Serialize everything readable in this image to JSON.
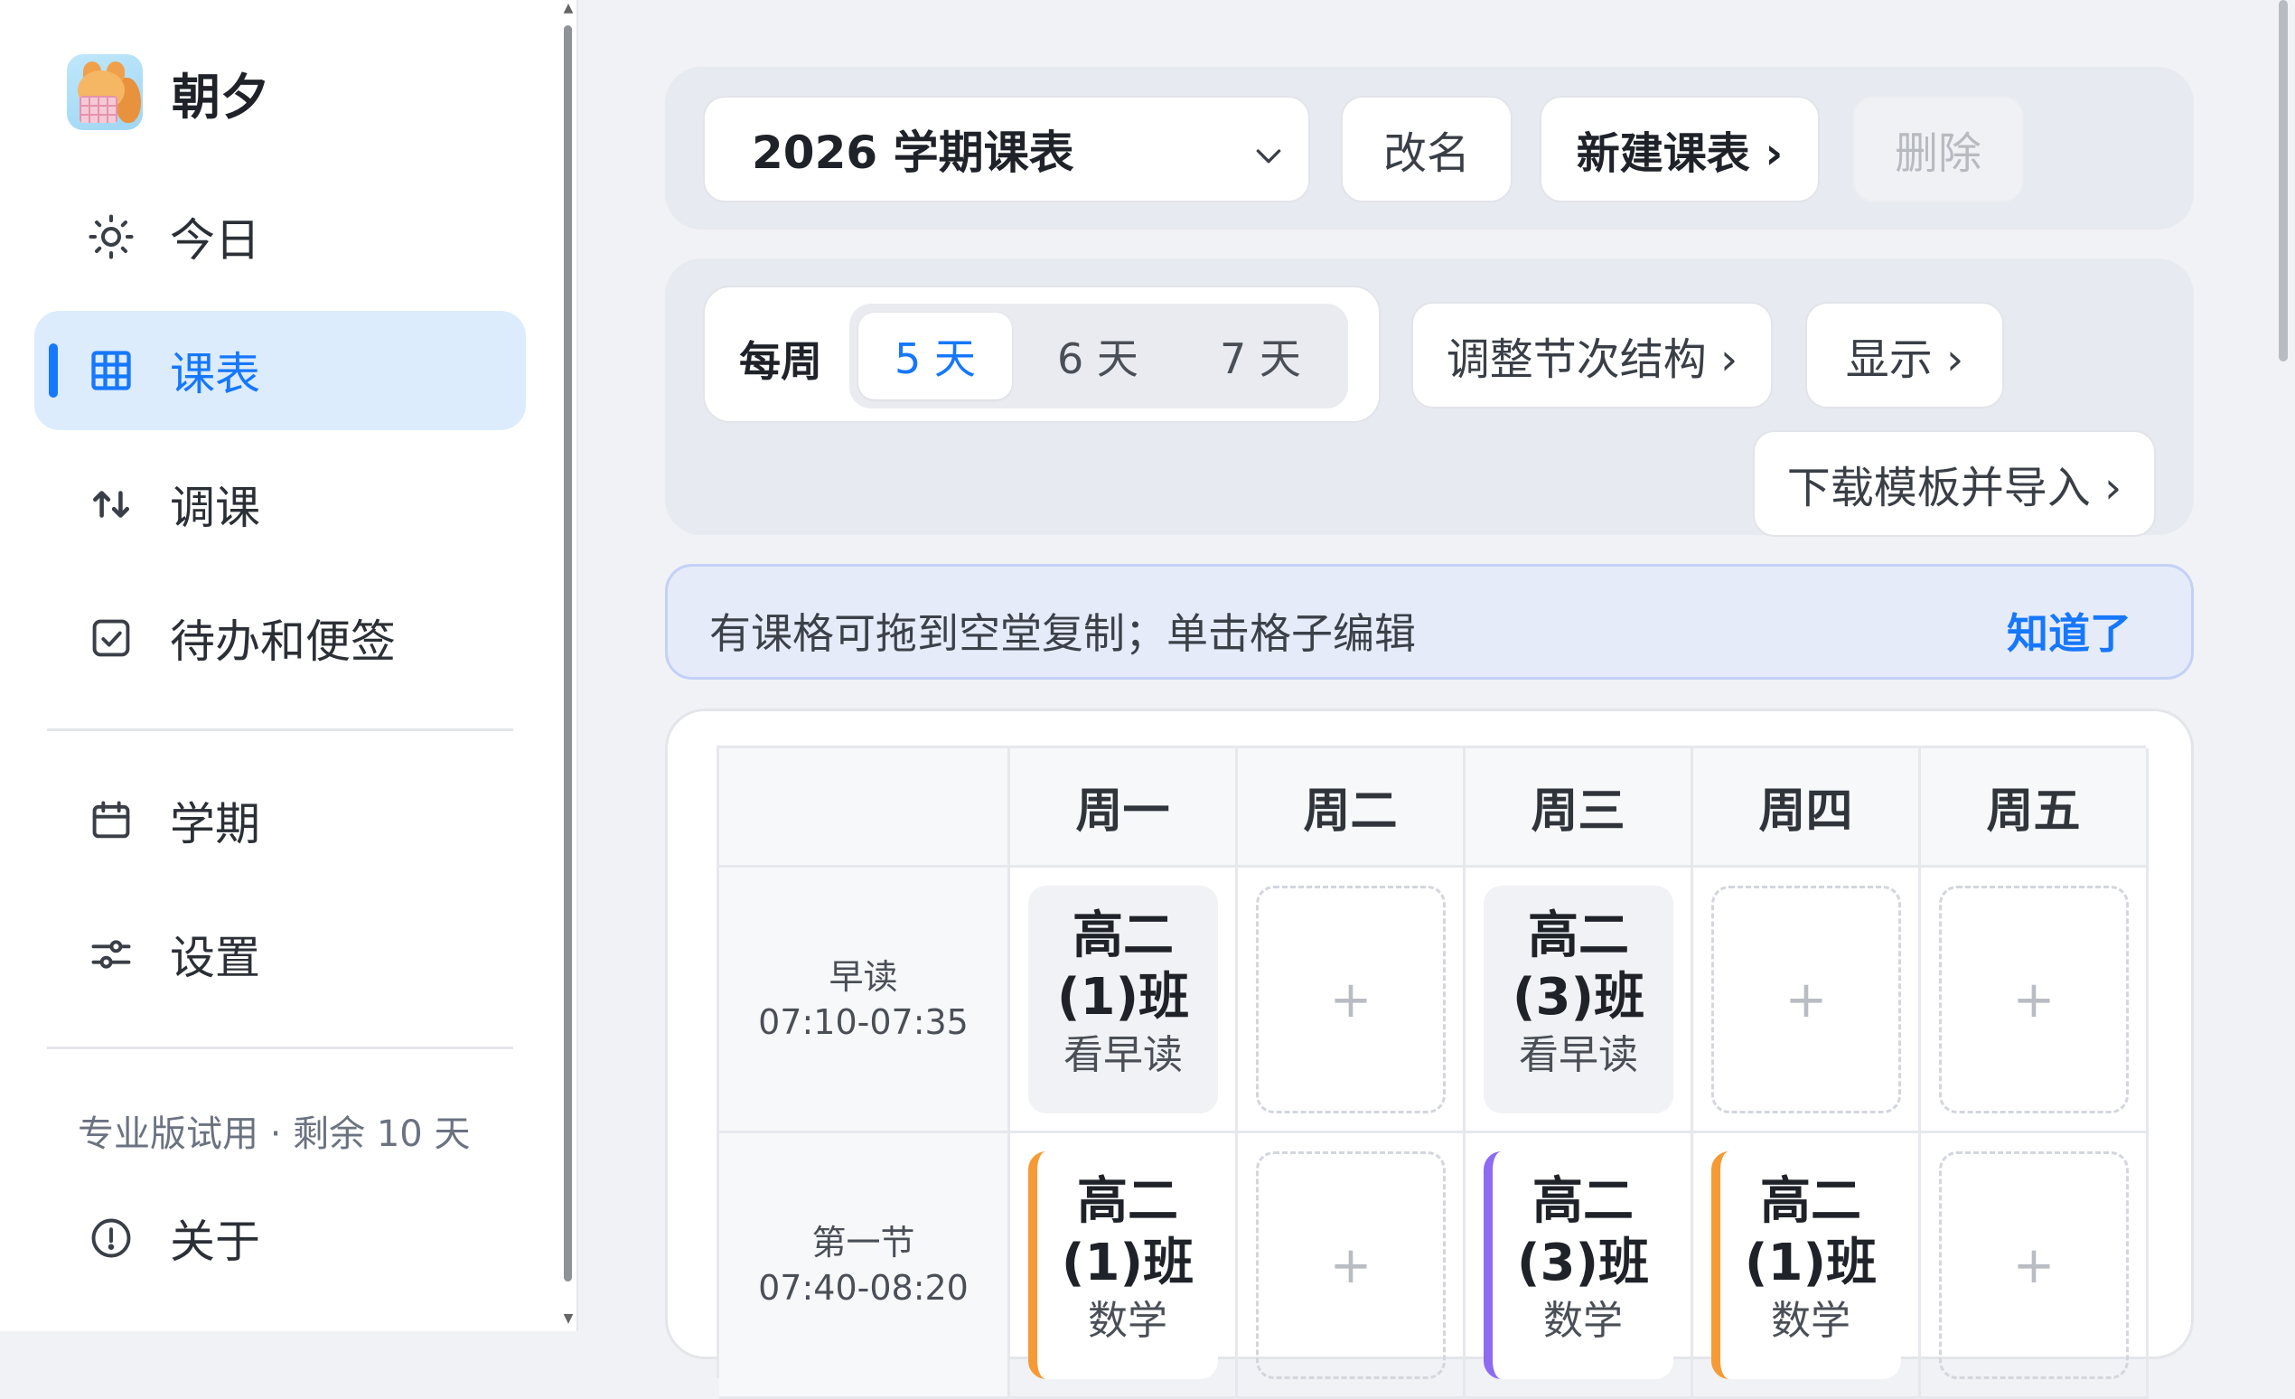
{
  "app": {
    "name": "朝夕"
  },
  "nav": {
    "today": "今日",
    "schedule": "课表",
    "swap": "调课",
    "todo": "待办和便签",
    "term": "学期",
    "settings": "设置",
    "about": "关于"
  },
  "trial": "专业版试用 · 剩余 10 天",
  "toolbar": {
    "timetable_select": "2026 学期课表",
    "rename": "改名",
    "new_timetable": "新建课表 ›",
    "delete": "删除"
  },
  "week": {
    "label": "每周",
    "options": [
      "5 天",
      "6 天",
      "7 天"
    ],
    "selected": "5 天",
    "adjust_periods": "调整节次结构 ›",
    "display": "显示 ›",
    "import": "下载模板并导入 ›"
  },
  "tip": {
    "text": "有课格可拖到空堂复制；单击格子编辑",
    "dismiss": "知道了"
  },
  "timetable": {
    "days": [
      "周一",
      "周二",
      "周三",
      "周四",
      "周五"
    ],
    "periods": [
      {
        "name": "早读",
        "time": "07:10-07:35",
        "cells": [
          {
            "class": "高二",
            "section": "(1)班",
            "subject": "看早读"
          },
          {
            "empty": "+"
          },
          {
            "class": "高二",
            "section": "(3)班",
            "subject": "看早读"
          },
          {
            "empty": "+"
          },
          {
            "empty": "+"
          }
        ]
      },
      {
        "name": "第一节",
        "time": "07:40-08:20",
        "cells": [
          {
            "class": "高二",
            "section": "(1)班",
            "subject": "数学"
          },
          {
            "empty": "+"
          },
          {
            "class": "高二",
            "section": "(3)班",
            "subject": "数学"
          },
          {
            "class": "高二",
            "section": "(1)班",
            "subject": "数学"
          },
          {
            "empty": "+"
          }
        ]
      }
    ]
  },
  "colors": {
    "accent": "#1677ff",
    "active_nav_bg": "#dcecfd",
    "class1_accent": "#f59a35",
    "class3_accent": "#8c6cf0"
  }
}
